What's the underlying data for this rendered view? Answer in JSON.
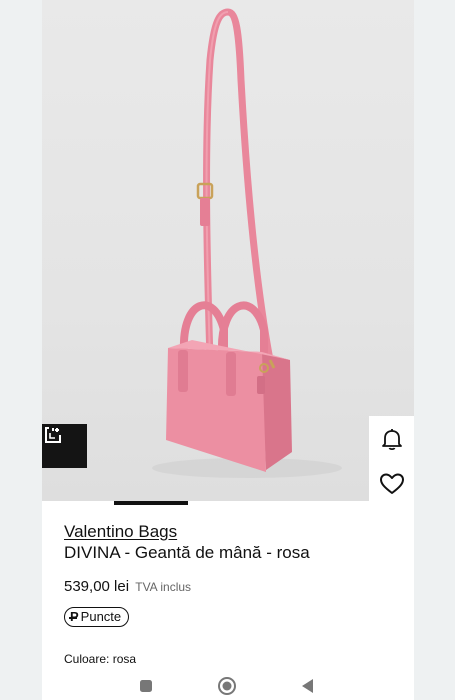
{
  "product": {
    "brand": "Valentino Bags",
    "name": "DIVINA  - Geantă de mână - rosa",
    "price": "539,00 lei",
    "vat_note": "TVA inclus",
    "points_label": "Puncte",
    "color_line": "Culoare: rosa"
  },
  "gallery": {
    "active_index": 1
  },
  "icons": {
    "ar": "view-in-room-icon",
    "bell": "bell-icon",
    "heart": "heart-icon",
    "nav_recent": "square-icon",
    "nav_home": "circle-icon",
    "nav_back": "back-triangle-icon"
  },
  "colors": {
    "bag": "#ec8fa2",
    "bag_shadow": "#d9758b",
    "hardware": "#c9a25a"
  }
}
